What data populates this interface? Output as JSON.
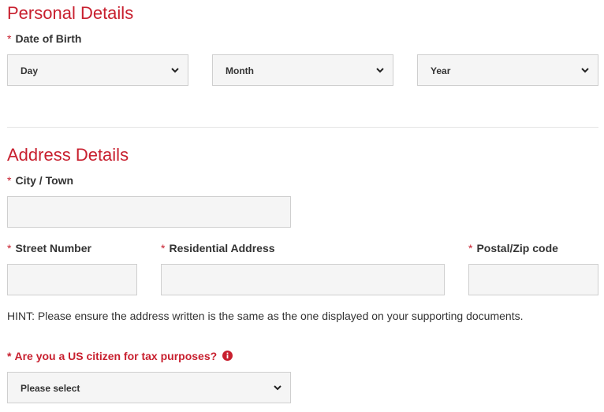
{
  "personal": {
    "heading": "Personal Details",
    "dob_label": "Date of Birth",
    "required_marker": "*",
    "day_placeholder": "Day",
    "month_placeholder": "Month",
    "year_placeholder": "Year"
  },
  "address": {
    "heading": "Address Details",
    "city_label": "City / Town",
    "street_number_label": "Street Number",
    "residential_address_label": "Residential Address",
    "postal_code_label": "Postal/Zip code",
    "city_value": "",
    "street_number_value": "",
    "residential_address_value": "",
    "postal_code_value": "",
    "hint": "HINT: Please ensure the address written is the same as the one displayed on your supporting documents."
  },
  "tax": {
    "question": "Are you a US citizen for tax purposes?",
    "select_placeholder": "Please select",
    "info_icon": "info-circle-icon"
  },
  "colors": {
    "accent_red": "#c8202f",
    "field_bg": "#f5f5f5",
    "field_border": "#cfcfcf",
    "text": "#333333"
  }
}
